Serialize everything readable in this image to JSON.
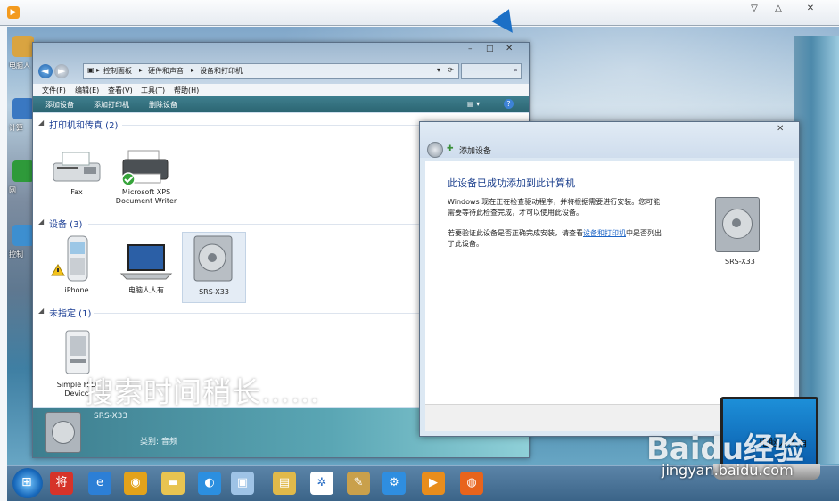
{
  "player": {
    "controls": [
      "▽",
      "△",
      "✕"
    ]
  },
  "desktop": {
    "icons": [
      {
        "label": "电脑人",
        "color": "#d9a441"
      },
      {
        "label": "计算",
        "color": "#3a78c2"
      },
      {
        "label": "网",
        "color": "#2e9a3a"
      },
      {
        "label": "控制",
        "color": "#3d8fd0"
      }
    ]
  },
  "explorer": {
    "breadcrumbs": [
      "控制面板",
      "硬件和声音",
      "设备和打印机"
    ],
    "menu": [
      "文件(F)",
      "编辑(E)",
      "查看(V)",
      "工具(T)",
      "帮助(H)"
    ],
    "toolbar": [
      "添加设备",
      "添加打印机",
      "删除设备"
    ],
    "groups": [
      {
        "title": "打印机和传真 (2)"
      },
      {
        "title": "设备 (3)"
      },
      {
        "title": "未指定 (1)"
      }
    ],
    "printers": [
      {
        "line1": "Fax",
        "line2": ""
      },
      {
        "line1": "Microsoft XPS",
        "line2": "Document Writer"
      }
    ],
    "devices": [
      {
        "label": "iPhone"
      },
      {
        "label": "电脑人人有"
      },
      {
        "label": "SRS-X33"
      }
    ],
    "unspecified": [
      {
        "line1": "Simple HID",
        "line2": "Device"
      }
    ],
    "detail": {
      "name": "SRS-X33",
      "sub": "类别: 音频"
    },
    "overlay_text": "搜索时间稍长……"
  },
  "dialog": {
    "title": "添加设备",
    "heading": "此设备已成功添加到此计算机",
    "para1_line1": "Windows 现在正在检查驱动程序，并将根据需要进行安装。您可能",
    "para1_line2": "需要等待此检查完成，才可以使用此设备。",
    "para2_pre": "若要验证此设备是否正确完成安装，请查看",
    "para2_link": "设备和打印机",
    "para2_post": "中是否列出",
    "para2_line2": "了此设备。",
    "device_name": "SRS-X33"
  },
  "taskbar": {
    "icons": [
      {
        "name": "jiang-app-icon",
        "color": "#d6332a",
        "glyph": "将"
      },
      {
        "name": "ie-icon",
        "color": "#2c7fd6",
        "glyph": "e"
      },
      {
        "name": "chrome-icon",
        "color": "#e3a21a",
        "glyph": "◉"
      },
      {
        "name": "folder-icon",
        "color": "#e8c451",
        "glyph": "▬"
      },
      {
        "name": "qq-browser-icon",
        "color": "#2b8fe0",
        "glyph": "◐"
      },
      {
        "name": "devices-icon",
        "color": "#9ec3e6",
        "glyph": "▣"
      },
      {
        "name": "explorer-icon",
        "color": "#e0b94a",
        "glyph": "▤"
      },
      {
        "name": "pinwheel-icon",
        "color": "#ffffff",
        "glyph": "✲"
      },
      {
        "name": "paint-icon",
        "color": "#c9a04b",
        "glyph": "✎"
      },
      {
        "name": "settings-icon",
        "color": "#2f8ee0",
        "glyph": "⚙"
      },
      {
        "name": "media-icon",
        "color": "#e88d1c",
        "glyph": "▶"
      },
      {
        "name": "firefox-icon",
        "color": "#e8641c",
        "glyph": "◍"
      }
    ]
  },
  "laptop": {
    "screen_text": "电脑人人有"
  },
  "watermark": {
    "brand": "Baidu经验",
    "url": "jingyan.baidu.com"
  },
  "colors": {
    "link": "#1c64c6",
    "heading": "#1a3e8c",
    "group": "#1c3f95"
  }
}
